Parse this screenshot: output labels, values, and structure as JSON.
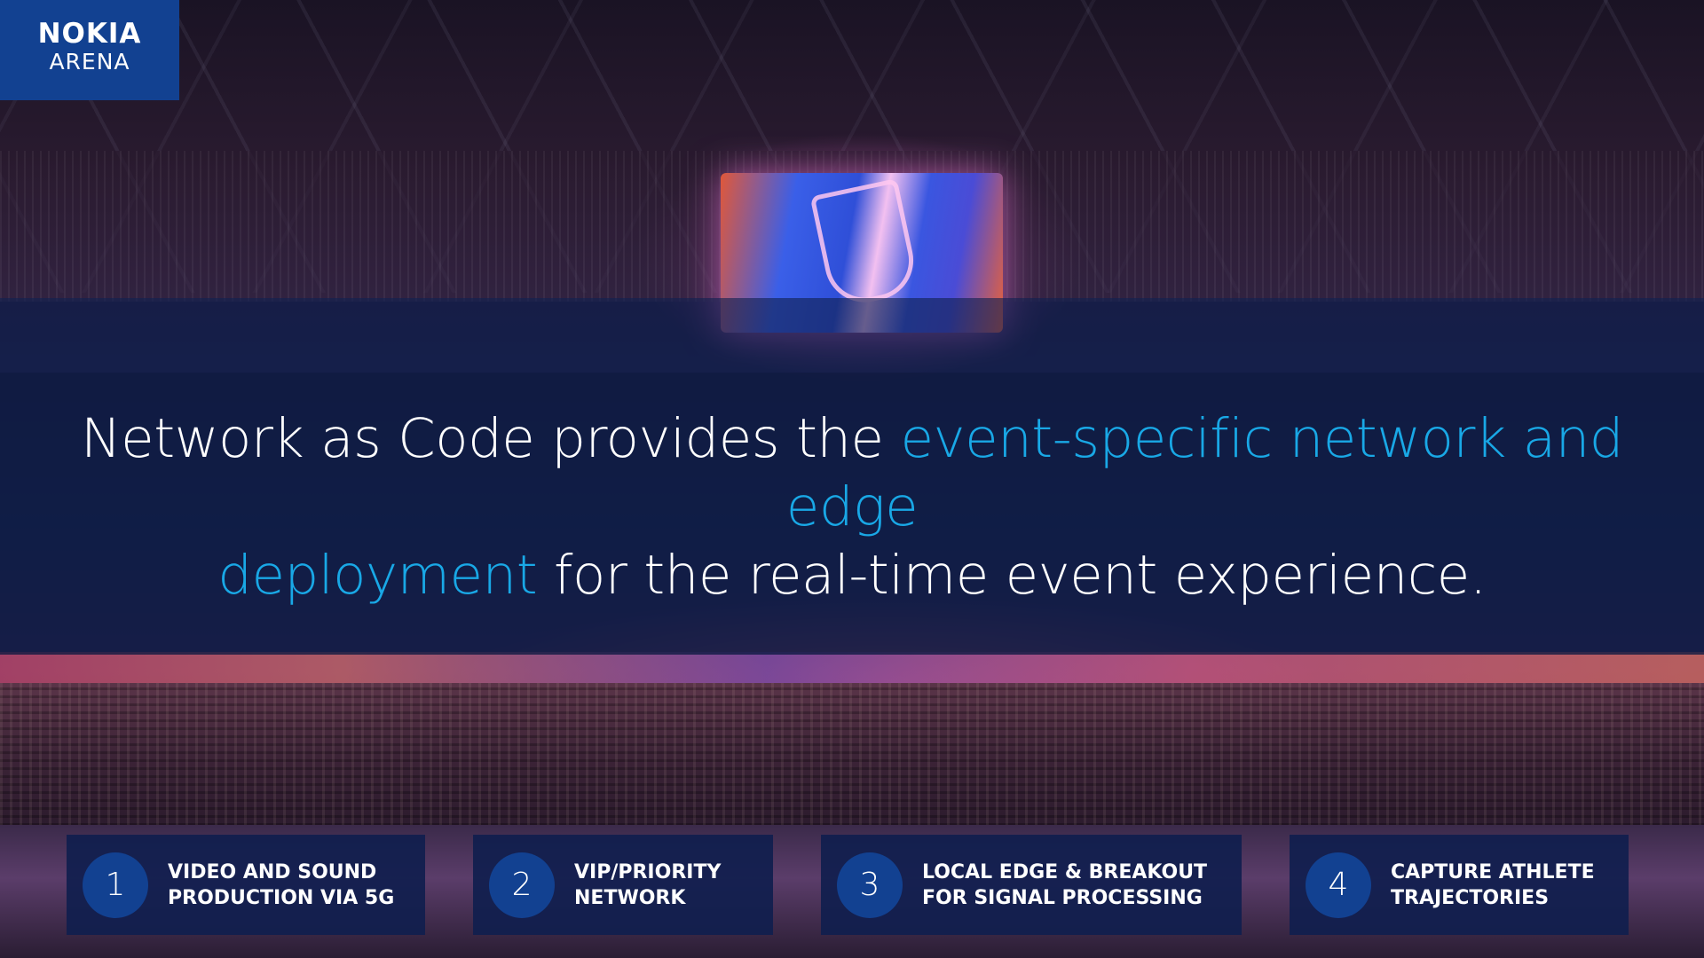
{
  "logo": {
    "brand": "NOKIA",
    "venue": "ARENA"
  },
  "headline": {
    "part1": "Network as Code provides the ",
    "highlight1": "event-specific network and edge",
    "highlight2": "deployment",
    "part2": " for the real-time event experience."
  },
  "colors": {
    "accent": "#19a8e6",
    "brand_blue": "#124191",
    "panel": "#0e1a42"
  },
  "cards": [
    {
      "number": "1",
      "line1": "VIDEO AND SOUND",
      "line2": "PRODUCTION VIA 5G"
    },
    {
      "number": "2",
      "line1": "VIP/PRIORITY",
      "line2": "NETWORK"
    },
    {
      "number": "3",
      "line1": "LOCAL EDGE &  BREAKOUT",
      "line2": "FOR SIGNAL PROCESSING"
    },
    {
      "number": "4",
      "line1": "CAPTURE ATHLETE",
      "line2": "TRAJECTORIES"
    }
  ]
}
